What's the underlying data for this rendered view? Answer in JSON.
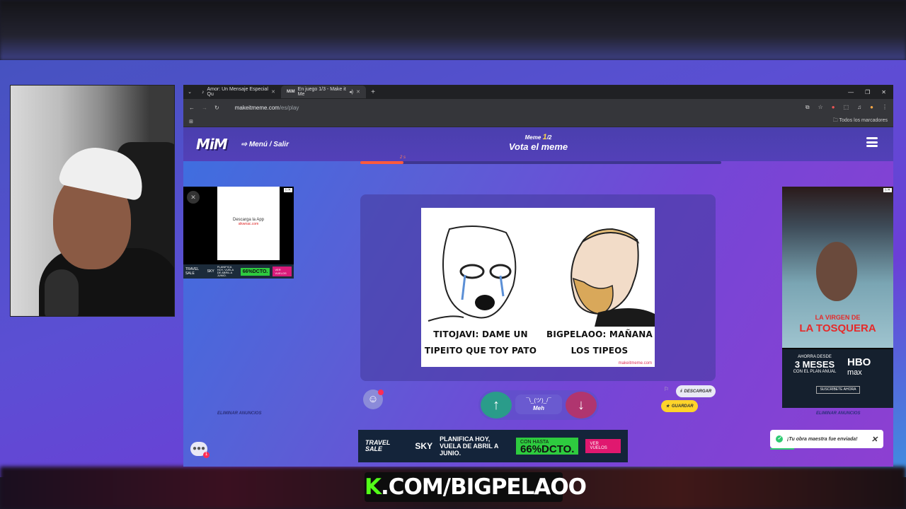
{
  "browser": {
    "tabs": [
      {
        "label": "Amor: Un Mensaje Especial Qu",
        "icon": "tiktok-icon"
      },
      {
        "label": "En juego 1/3 - Make it Me",
        "icon": "mim-icon"
      }
    ],
    "url_host": "makeitmeme.com",
    "url_path": "/es/play",
    "bookmarks_label": "Todos los marcadores"
  },
  "site": {
    "logo": "MiM",
    "menu_link": "Menú / Salir",
    "round_prefix": "Meme",
    "round_current": "1",
    "round_total": "/2",
    "vote_title": "Vota el meme",
    "timer_label": "2 s",
    "timer_progress": 0.12
  },
  "meme": {
    "left_caption": "TITOJAVI: DAME UN TIPEITO QUE TOY PATO",
    "right_caption": "BIGPELAOO: MAÑANA LOS TIPEOS",
    "watermark": "makeitmeme.com"
  },
  "voting": {
    "kaomoji": "¯\\_(ツ)_/¯",
    "meh_label": "Meh",
    "download_label": "DESCARGAR",
    "save_label": "GUARDAR",
    "remove_ads_label": "ELIMINAR ANUNCIOS"
  },
  "ads": {
    "left_app_text": "Descarga la App",
    "left_app_site": "sikwnac.com",
    "travel_brand": "TRAVEL SALE",
    "sky": "SKY",
    "plan_text": "PLANIFICA HOY, VUELA DE ABRIL A JUNIO.",
    "deal_small": "CON HASTA",
    "deal_big": "66%DCTO.",
    "cta": "VER VUELOS",
    "right_title_1": "LA VIRGEN DE",
    "right_title_2": "LA TOSQUERA",
    "right_promo_1": "AHORRA DESDE",
    "right_promo_2": "3 MESES",
    "right_promo_3": "CON EL PLAN ANUAL",
    "right_brand_1": "HBO",
    "right_brand_2": "max",
    "right_cta": "SUSCRÍBETE AHORA"
  },
  "toast": {
    "message": "¡Tu obra maestra fue enviada!"
  },
  "chat": {
    "badge": "1"
  },
  "overlay": {
    "k": "K",
    "text": ".COM/BIGPELAOO"
  },
  "colors": {
    "accent_green": "#53fc18",
    "vote_up": "#2a9c8a",
    "vote_down": "#b0356f",
    "save_yellow": "#ffd42a"
  }
}
